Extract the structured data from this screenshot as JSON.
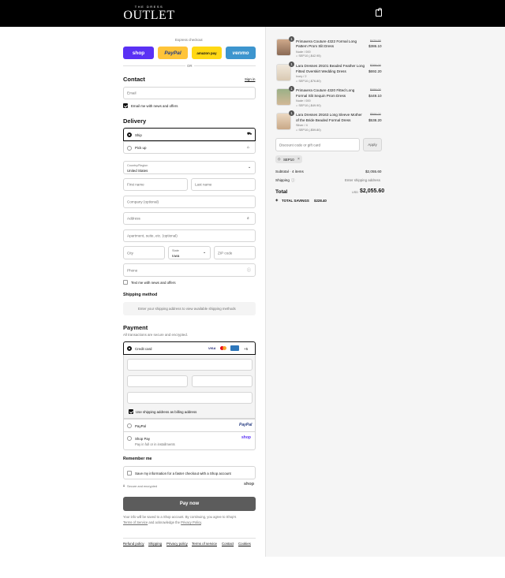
{
  "brand": {
    "small": "THE DRESS",
    "big": "OUTLET"
  },
  "express": {
    "title": "Express checkout",
    "shop": "shop",
    "paypal": "PayPal",
    "amazon": "amazon pay",
    "venmo": "venmo",
    "or": "OR"
  },
  "contact": {
    "heading": "Contact",
    "signin": "Sign in",
    "email_placeholder": "Email",
    "news": "Email me with news and offers"
  },
  "delivery": {
    "heading": "Delivery",
    "ship": "Ship",
    "pickup": "Pick up",
    "country_label": "Country/Region",
    "country": "United States",
    "first": "First name",
    "last": "Last name",
    "company": "Company (optional)",
    "address": "Address",
    "apartment": "Apartment, suite, etc. (optional)",
    "city": "City",
    "state_label": "State",
    "state": "Iowa",
    "zip": "ZIP code",
    "phone": "Phone",
    "text_news": "Text me with news and offers"
  },
  "shipping": {
    "heading": "Shipping method",
    "note": "Enter your shipping address to view available shipping methods"
  },
  "payment": {
    "heading": "Payment",
    "secure": "All transactions are secure and encrypted.",
    "credit": "Credit card",
    "more": "+5",
    "billing": "Use shipping address as billing address",
    "paypal": "PayPal",
    "paypal_logo": "PayPal",
    "shoppay": "Shop Pay",
    "shoppay_sub": "Pay in full or in installments",
    "shop_logo": "shop"
  },
  "remember": {
    "heading": "Remember me",
    "save": "Save my information for a faster checkout with a Shop account",
    "secure": "Secure and encrypted",
    "shop_logo": "shop"
  },
  "pay_now": "Pay now",
  "legal": {
    "part1": "Your info will be saved to a Shop account. By continuing, you agree to Shop's",
    "terms": "Terms of Service",
    "part2": "and acknowledge the",
    "privacy": "Privacy Policy",
    "end": "."
  },
  "footer": [
    "Refund policy",
    "Shipping",
    "Privacy policy",
    "Terms of service",
    "Contact",
    "Cookies"
  ],
  "items": [
    {
      "qty": "1",
      "name1": "Primavera Couture 4322 Formal Long",
      "name2": "Pattern Prom Slit Dress",
      "variant": "Nude / 000",
      "discount": "SEP10 (-$42.95)",
      "old": "$429.55",
      "price": "$386.10"
    },
    {
      "qty": "1",
      "name1": "Lara Dresses 29101 Beaded Feather Long",
      "name2": "Fitted Overskirt Wedding Dress",
      "variant": "Ivory / 2",
      "discount": "SEP10 (-$76.80)",
      "old": "$768.00",
      "price": "$692.20"
    },
    {
      "qty": "1",
      "name1": "Primavera Couture 4320 Fitted Long",
      "name2": "Formal Slit Sequin Prom Dress",
      "variant": "Nude / 000",
      "discount": "SEP10 (-$49.90)",
      "old": "$499.00",
      "price": "$449.10"
    },
    {
      "qty": "1",
      "name1": "Lara Dresses 29163 Long Sleeve Mother",
      "name2": "of the Bride Beaded Formal Dress",
      "variant": "Silver / 4",
      "discount": "SEP10 (-$59.80)",
      "old": "$598.00",
      "price": "$538.20"
    }
  ],
  "summary": {
    "discount_placeholder": "Discount code or gift card",
    "apply": "Apply",
    "code": "SEP10",
    "subtotal_label": "Subtotal · 4 items",
    "subtotal": "$2,055.60",
    "shipping_label": "Shipping",
    "shipping_value": "Enter shipping address",
    "total_label": "Total",
    "currency": "USD",
    "total": "$2,055.60",
    "savings_label": "TOTAL SAVINGS",
    "savings": "$228.40"
  }
}
